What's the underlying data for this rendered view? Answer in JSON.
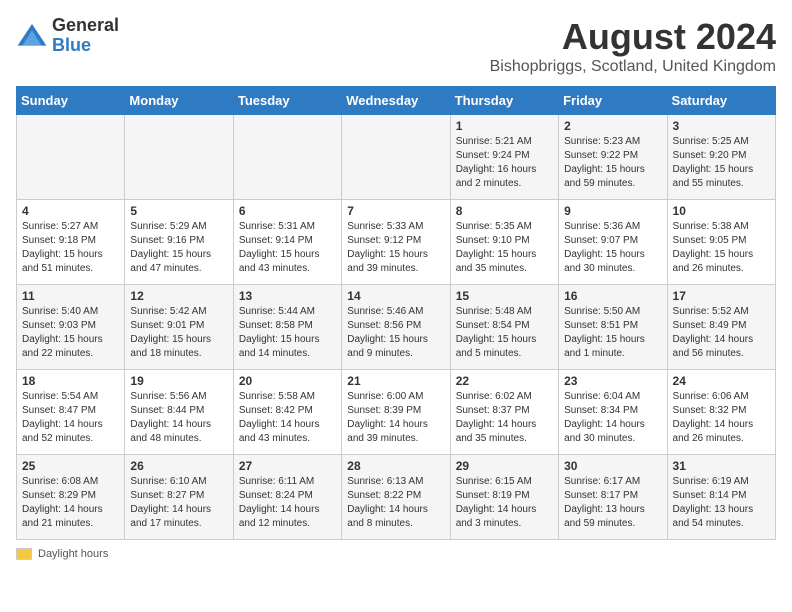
{
  "header": {
    "logo_general": "General",
    "logo_blue": "Blue",
    "main_title": "August 2024",
    "subtitle": "Bishopbriggs, Scotland, United Kingdom"
  },
  "days_of_week": [
    "Sunday",
    "Monday",
    "Tuesday",
    "Wednesday",
    "Thursday",
    "Friday",
    "Saturday"
  ],
  "weeks": [
    [
      {
        "day": "",
        "info": ""
      },
      {
        "day": "",
        "info": ""
      },
      {
        "day": "",
        "info": ""
      },
      {
        "day": "",
        "info": ""
      },
      {
        "day": "1",
        "info": "Sunrise: 5:21 AM\nSunset: 9:24 PM\nDaylight: 16 hours\nand 2 minutes."
      },
      {
        "day": "2",
        "info": "Sunrise: 5:23 AM\nSunset: 9:22 PM\nDaylight: 15 hours\nand 59 minutes."
      },
      {
        "day": "3",
        "info": "Sunrise: 5:25 AM\nSunset: 9:20 PM\nDaylight: 15 hours\nand 55 minutes."
      }
    ],
    [
      {
        "day": "4",
        "info": "Sunrise: 5:27 AM\nSunset: 9:18 PM\nDaylight: 15 hours\nand 51 minutes."
      },
      {
        "day": "5",
        "info": "Sunrise: 5:29 AM\nSunset: 9:16 PM\nDaylight: 15 hours\nand 47 minutes."
      },
      {
        "day": "6",
        "info": "Sunrise: 5:31 AM\nSunset: 9:14 PM\nDaylight: 15 hours\nand 43 minutes."
      },
      {
        "day": "7",
        "info": "Sunrise: 5:33 AM\nSunset: 9:12 PM\nDaylight: 15 hours\nand 39 minutes."
      },
      {
        "day": "8",
        "info": "Sunrise: 5:35 AM\nSunset: 9:10 PM\nDaylight: 15 hours\nand 35 minutes."
      },
      {
        "day": "9",
        "info": "Sunrise: 5:36 AM\nSunset: 9:07 PM\nDaylight: 15 hours\nand 30 minutes."
      },
      {
        "day": "10",
        "info": "Sunrise: 5:38 AM\nSunset: 9:05 PM\nDaylight: 15 hours\nand 26 minutes."
      }
    ],
    [
      {
        "day": "11",
        "info": "Sunrise: 5:40 AM\nSunset: 9:03 PM\nDaylight: 15 hours\nand 22 minutes."
      },
      {
        "day": "12",
        "info": "Sunrise: 5:42 AM\nSunset: 9:01 PM\nDaylight: 15 hours\nand 18 minutes."
      },
      {
        "day": "13",
        "info": "Sunrise: 5:44 AM\nSunset: 8:58 PM\nDaylight: 15 hours\nand 14 minutes."
      },
      {
        "day": "14",
        "info": "Sunrise: 5:46 AM\nSunset: 8:56 PM\nDaylight: 15 hours\nand 9 minutes."
      },
      {
        "day": "15",
        "info": "Sunrise: 5:48 AM\nSunset: 8:54 PM\nDaylight: 15 hours\nand 5 minutes."
      },
      {
        "day": "16",
        "info": "Sunrise: 5:50 AM\nSunset: 8:51 PM\nDaylight: 15 hours\nand 1 minute."
      },
      {
        "day": "17",
        "info": "Sunrise: 5:52 AM\nSunset: 8:49 PM\nDaylight: 14 hours\nand 56 minutes."
      }
    ],
    [
      {
        "day": "18",
        "info": "Sunrise: 5:54 AM\nSunset: 8:47 PM\nDaylight: 14 hours\nand 52 minutes."
      },
      {
        "day": "19",
        "info": "Sunrise: 5:56 AM\nSunset: 8:44 PM\nDaylight: 14 hours\nand 48 minutes."
      },
      {
        "day": "20",
        "info": "Sunrise: 5:58 AM\nSunset: 8:42 PM\nDaylight: 14 hours\nand 43 minutes."
      },
      {
        "day": "21",
        "info": "Sunrise: 6:00 AM\nSunset: 8:39 PM\nDaylight: 14 hours\nand 39 minutes."
      },
      {
        "day": "22",
        "info": "Sunrise: 6:02 AM\nSunset: 8:37 PM\nDaylight: 14 hours\nand 35 minutes."
      },
      {
        "day": "23",
        "info": "Sunrise: 6:04 AM\nSunset: 8:34 PM\nDaylight: 14 hours\nand 30 minutes."
      },
      {
        "day": "24",
        "info": "Sunrise: 6:06 AM\nSunset: 8:32 PM\nDaylight: 14 hours\nand 26 minutes."
      }
    ],
    [
      {
        "day": "25",
        "info": "Sunrise: 6:08 AM\nSunset: 8:29 PM\nDaylight: 14 hours\nand 21 minutes."
      },
      {
        "day": "26",
        "info": "Sunrise: 6:10 AM\nSunset: 8:27 PM\nDaylight: 14 hours\nand 17 minutes."
      },
      {
        "day": "27",
        "info": "Sunrise: 6:11 AM\nSunset: 8:24 PM\nDaylight: 14 hours\nand 12 minutes."
      },
      {
        "day": "28",
        "info": "Sunrise: 6:13 AM\nSunset: 8:22 PM\nDaylight: 14 hours\nand 8 minutes."
      },
      {
        "day": "29",
        "info": "Sunrise: 6:15 AM\nSunset: 8:19 PM\nDaylight: 14 hours\nand 3 minutes."
      },
      {
        "day": "30",
        "info": "Sunrise: 6:17 AM\nSunset: 8:17 PM\nDaylight: 13 hours\nand 59 minutes."
      },
      {
        "day": "31",
        "info": "Sunrise: 6:19 AM\nSunset: 8:14 PM\nDaylight: 13 hours\nand 54 minutes."
      }
    ]
  ],
  "footer": {
    "daylight_label": "Daylight hours",
    "daylight_color": "#f5c842"
  }
}
